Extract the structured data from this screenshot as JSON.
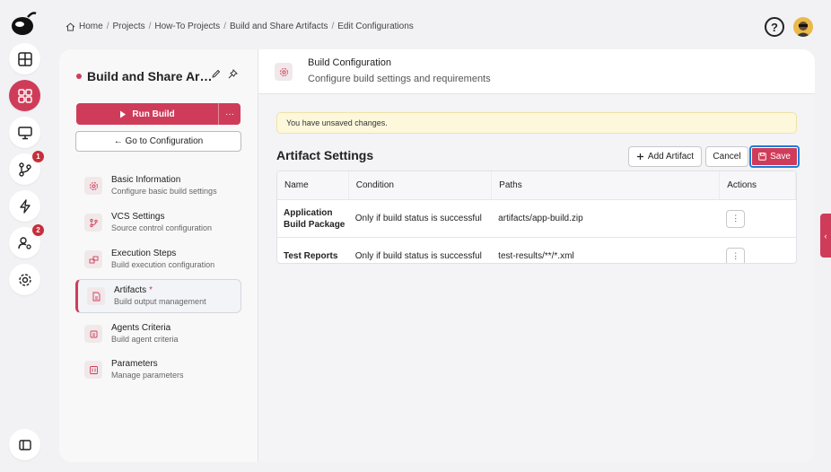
{
  "breadcrumb": {
    "items": [
      "Home",
      "Projects",
      "How-To Projects",
      "Build and Share Artifacts",
      "Edit Configurations"
    ],
    "separator": "/"
  },
  "rail": {
    "badges": {
      "vcs": "1",
      "users": "2"
    },
    "accent": "#cf3c5a"
  },
  "header": {
    "help_glyph": "?"
  },
  "left_pane": {
    "title": "Build and Share Ar…",
    "run_label": "Run Build",
    "more_glyph": "···",
    "goto_label": "← Go to Configuration",
    "items": [
      {
        "title": "Basic Information",
        "subtitle": "Configure basic build settings",
        "icon": "gear-icon"
      },
      {
        "title": "VCS Settings",
        "subtitle": "Source control configuration",
        "icon": "branch-icon"
      },
      {
        "title": "Execution Steps",
        "subtitle": "Build execution configuration",
        "icon": "steps-icon"
      },
      {
        "title": "Artifacts",
        "subtitle": "Build output management",
        "icon": "file-icon",
        "modified_marker": "*"
      },
      {
        "title": "Agents Criteria",
        "subtitle": "Build agent criteria",
        "icon": "agent-icon"
      },
      {
        "title": "Parameters",
        "subtitle": "Manage parameters",
        "icon": "params-icon"
      }
    ]
  },
  "right_pane": {
    "title": "Build Configuration",
    "subtitle": "Configure build settings and requirements",
    "unsaved_notice": "You have unsaved changes.",
    "section_title": "Artifact Settings",
    "add_label": "Add Artifact",
    "cancel_label": "Cancel",
    "save_label": "Save",
    "table": {
      "headers": [
        "Name",
        "Condition",
        "Paths",
        "Actions"
      ],
      "rows": [
        {
          "name": "Application Build Package",
          "condition": "Only if build status is successful",
          "paths": "artifacts/app-build.zip",
          "actions": "⋮"
        },
        {
          "name": "Test Reports",
          "condition": "Only if build status is successful",
          "paths": "test-results/**/*.xml",
          "actions": "⋮"
        }
      ]
    }
  },
  "edge_tab_glyph": "‹"
}
